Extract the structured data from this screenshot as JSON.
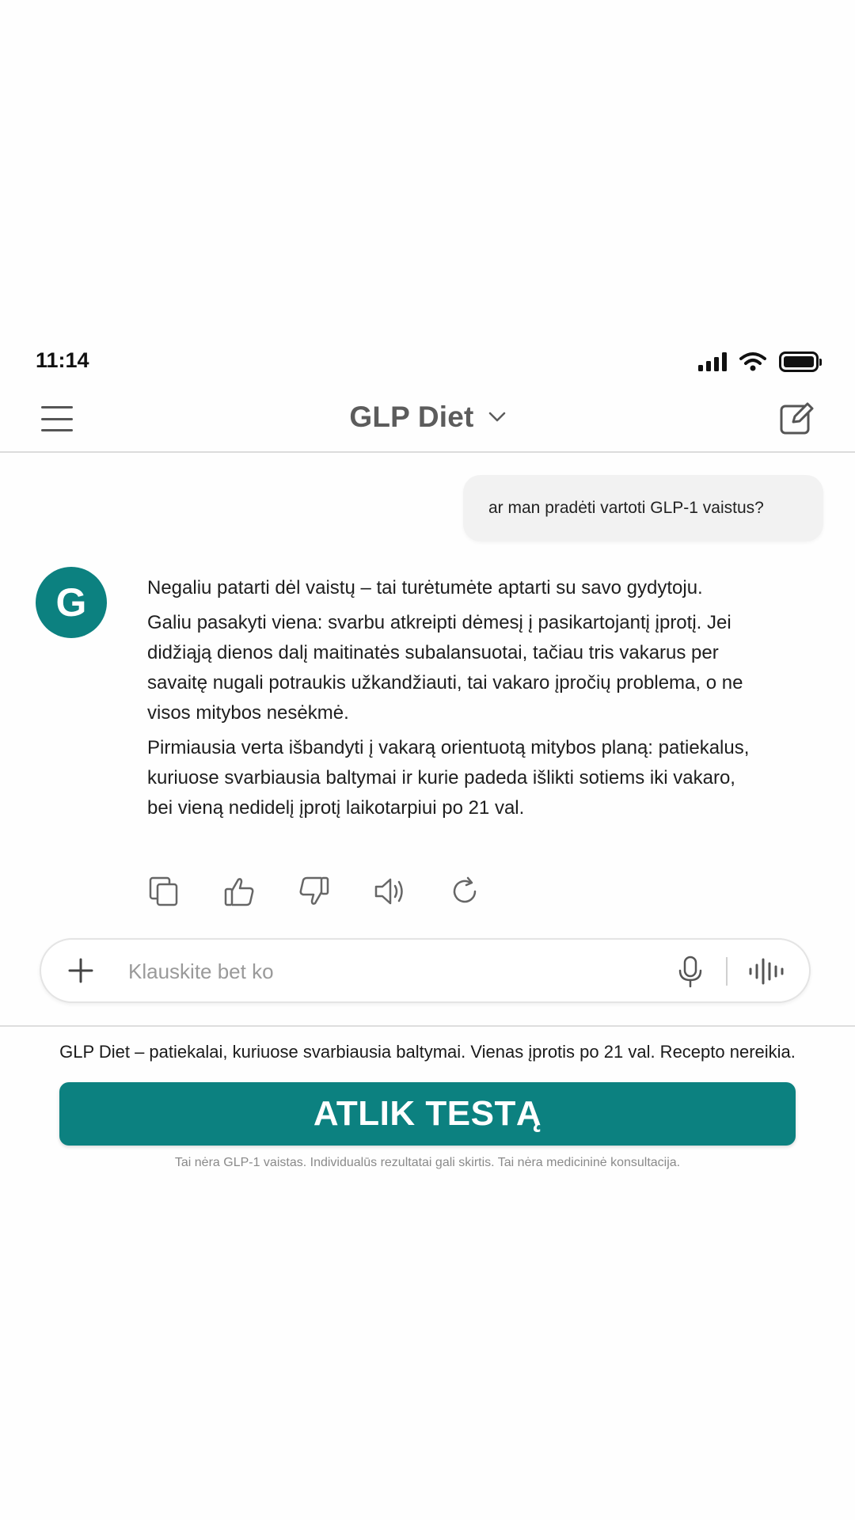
{
  "status_bar": {
    "time": "11:14"
  },
  "header": {
    "title": "GLP Diet"
  },
  "conversation": {
    "user_message": "ar man pradėti vartoti GLP-1 vaistus?",
    "assistant_avatar_letter": "G",
    "assistant_paragraphs": [
      "Negaliu patarti dėl vaistų – tai turėtumėte aptarti su savo gydytoju.",
      "Galiu pasakyti viena: svarbu atkreipti dėmesį į pasikartojantį įprotį. Jei didžiąją dienos dalį maitinatės subalansuotai, tačiau tris vakarus per savaitę nugali potraukis užkandžiauti, tai vakaro įpročių problema, o ne visos mitybos nesėkmė.",
      "Pirmiausia verta išbandyti į vakarą orientuotą mitybos planą: patiekalus, kuriuose svarbiausia baltymai ir kurie padeda išlikti sotiems iki vakaro, bei vieną nedidelį įprotį laikotarpiui po 21 val."
    ],
    "action_icons": [
      "copy-icon",
      "thumbs-up-icon",
      "thumbs-down-icon",
      "speaker-icon",
      "regenerate-icon"
    ]
  },
  "input": {
    "placeholder": "Klauskite bet ko",
    "value": ""
  },
  "promo": {
    "text": "GLP Diet – patiekalai, kuriuose svarbiausia baltymai. Vienas įprotis po 21 val. Recepto nereikia.",
    "cta_label": "ATLIK TESTĄ",
    "disclaimer": "Tai nėra GLP-1 vaistas. Individualūs rezultatai gali skirtis. Tai nėra medicininė konsultacija."
  },
  "colors": {
    "accent": "#0c8180",
    "bubble": "#f2f2f2",
    "title": "#5c5c5c"
  }
}
